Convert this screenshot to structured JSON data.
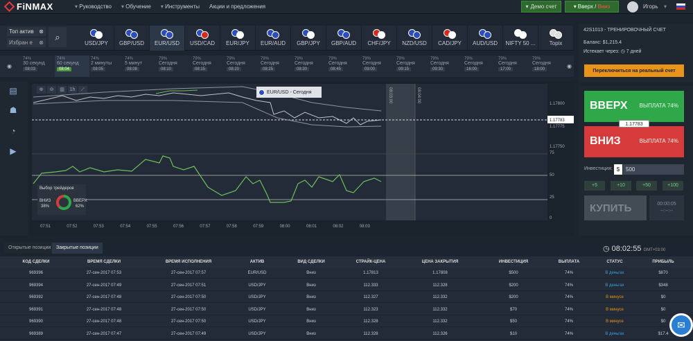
{
  "header": {
    "logo": "FiNMAX",
    "nav": [
      "Руководство",
      "Обучение",
      "Инструменты",
      "Акции и предложения"
    ],
    "demo_label": "Демо счет",
    "up_label": "Вверх",
    "sep": "/",
    "down_label": "Вниз",
    "username": "Игорь"
  },
  "assetbar": {
    "top_label": "Топ актив",
    "fav_label": "Избран е",
    "assets": [
      "USD/JPY",
      "GBP/USD",
      "EUR/USD",
      "USD/CAD",
      "EUR/JPY",
      "EUR/AUD",
      "GBP/JPY",
      "GBP/AUD",
      "CHF/JPY",
      "NZD/USD",
      "CAD/JPY",
      "AUD/USD",
      "NIFTY 50 ...",
      "Topix"
    ],
    "selected_index": 2
  },
  "timebar": {
    "cells": [
      {
        "pct": "74%",
        "label": "30 секунд",
        "time": "08:03"
      },
      {
        "pct": "74%",
        "label": "60 секунд",
        "time": "08:04"
      },
      {
        "pct": "74%",
        "label": "2 минуты",
        "time": "08:05"
      },
      {
        "pct": "74%",
        "label": "5 минут",
        "time": "08:08"
      },
      {
        "pct": "79%",
        "label": "Сегодня",
        "time": "08:10"
      },
      {
        "pct": "79%",
        "label": "Сегодня",
        "time": "08:15"
      },
      {
        "pct": "79%",
        "label": "Сегодня",
        "time": "08:20"
      },
      {
        "pct": "79%",
        "label": "Сегодня",
        "time": "08:25"
      },
      {
        "pct": "79%",
        "label": "Сегодня",
        "time": "08:30"
      },
      {
        "pct": "79%",
        "label": "Сегодня",
        "time": "08:45"
      },
      {
        "pct": "79%",
        "label": "Сегодня",
        "time": "09:00"
      },
      {
        "pct": "79%",
        "label": "Сегодня",
        "time": "09:15"
      },
      {
        "pct": "79%",
        "label": "Сегодня",
        "time": "09:30"
      },
      {
        "pct": "79%",
        "label": "Сегодня",
        "time": "16:00"
      },
      {
        "pct": "79%",
        "label": "Сегодня",
        "time": "17:00"
      },
      {
        "pct": "79%",
        "label": "Сегодня",
        "time": "18:00"
      }
    ],
    "selected_index": 1
  },
  "chart": {
    "popup_asset": "EUR/USD - Сегодня",
    "popup_traders": "Выбор трейдеров",
    "down_label": "ВНИЗ",
    "down_pct": "38%",
    "up_label": "ВВЕРХ",
    "up_pct": "62%",
    "y_labels": [
      "1.17800",
      "1.17775",
      "1.17750"
    ],
    "current_price": "1.17783",
    "osc_labels": [
      "75",
      "50",
      "25",
      "0"
    ],
    "x_labels": [
      "07:51",
      "07:52",
      "07:53",
      "07:54",
      "07:55",
      "07:56",
      "07:57",
      "07:58",
      "07:59",
      "08:00",
      "08:01",
      "08:02",
      "08:03"
    ],
    "expiry1": "08:03:00",
    "expiry2": "08:04:00"
  },
  "account": {
    "id": "42S1013 - ТРЕНИРОВОЧНЫЙ СЧЕТ",
    "balance": "Баланс: $1,215.4",
    "expires": "Истекает через: ◷ 7 дней",
    "switch_label": "Переключиться на реальный счет"
  },
  "trade": {
    "up_label": "ВВЕРХ",
    "up_payout": "ВЫПЛАТА 74%",
    "down_label": "ВНИЗ",
    "down_payout": "ВЫПЛАТА 74%",
    "rate": "1.17783",
    "invest_label": "Инвестиция:",
    "currency": "$",
    "invest_value": "500",
    "increments": [
      "+5",
      "+10",
      "+50",
      "+100"
    ],
    "buy_label": "КУПИТЬ",
    "buy_time": "00:00:05",
    "buy_time2": "--:--:--"
  },
  "positions": {
    "tabs": [
      "Открытые позиции",
      "Закрытые позиции"
    ],
    "active_tab": 1,
    "clock": "08:02:55",
    "tz": "GMT+03:00",
    "columns": [
      "КОД СДЕЛКИ",
      "ВРЕМЯ СДЕЛКИ",
      "ВРЕМЯ ИСПОЛНЕНИЯ",
      "АКТИВ",
      "ВИД СДЕЛКИ",
      "СТРАЙК-ЦЕНА",
      "ЦЕНА ЗАКРЫТИЯ",
      "ИНВЕСТИЦИЯ",
      "ВЫПЛАТА",
      "СТАТУС",
      "ПРИБЫЛЬ"
    ],
    "rows": [
      [
        "969396",
        "27-сен-2017 07:53",
        "27-сен-2017 07:57",
        "EUR/USD",
        "Вниз",
        "1.17813",
        "1.17808",
        "$500",
        "74%",
        "В деньгах",
        "$870"
      ],
      [
        "969394",
        "27-сен-2017 07:49",
        "27-сен-2017 07:51",
        "USD/JPY",
        "Вниз",
        "112.333",
        "112.328",
        "$200",
        "74%",
        "В деньгах",
        "$348"
      ],
      [
        "969392",
        "27-сен-2017 07:48",
        "27-сен-2017 07:50",
        "USD/JPY",
        "Вниз",
        "112.327",
        "112.332",
        "$200",
        "74%",
        "В минусе",
        "$0"
      ],
      [
        "969391",
        "27-сен-2017 07:48",
        "27-сен-2017 07:50",
        "USD/JPY",
        "Вниз",
        "112.323",
        "112.332",
        "$70",
        "74%",
        "В минусе",
        "$0"
      ],
      [
        "969390",
        "27-сен-2017 07:48",
        "27-сен-2017 07:50",
        "USD/JPY",
        "Вниз",
        "112.328",
        "112.332",
        "$50",
        "74%",
        "В минусе",
        "$0"
      ],
      [
        "969389",
        "27-сен-2017 07:47",
        "27-сен-2017 07:49",
        "USD/JPY",
        "Вниз",
        "112.328",
        "112.326",
        "$10",
        "74%",
        "В деньгах",
        "$17.4"
      ]
    ]
  },
  "colors": {
    "up": "#2fa84a",
    "down": "#d63a3a",
    "accent": "#e8941a",
    "win": "#3aa0d8",
    "lose": "#e8941a"
  }
}
